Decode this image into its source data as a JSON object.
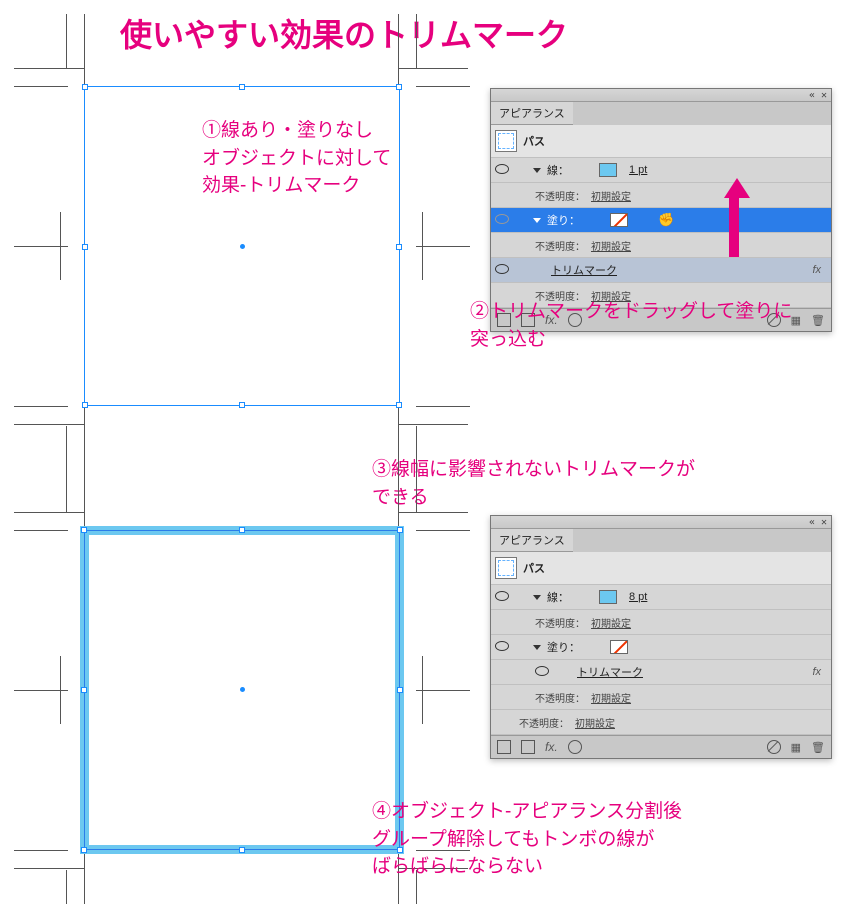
{
  "title": "使いやすい効果のトリムマーク",
  "annotations": {
    "a1_l1": "①線あり・塗りなし",
    "a1_l2": "オブジェクトに対して",
    "a1_l3": "効果-トリムマーク",
    "a2_l1": "②トリムマークをドラッグして塗りに",
    "a2_l2": "突っ込む",
    "a3_l1": "③線幅に影響されないトリムマークが",
    "a3_l2": "できる",
    "a4_l1": "④オブジェクト-アピアランス分割後",
    "a4_l2": "グループ解除してもトンボの線が",
    "a4_l3": "ばらばらにならない"
  },
  "panel1": {
    "tab": "アピアランス",
    "obj": "パス",
    "stroke_label": "線：",
    "stroke_value": "1 pt",
    "opacity_label": "不透明度：",
    "opacity_value": "初期設定",
    "fill_label": "塗り：",
    "trimmark_label": "トリムマーク",
    "fx": "fx"
  },
  "panel2": {
    "tab": "アピアランス",
    "obj": "パス",
    "stroke_label": "線：",
    "stroke_value": "8 pt",
    "opacity_label": "不透明度：",
    "opacity_value": "初期設定",
    "fill_label": "塗り：",
    "trimmark_label": "トリムマーク",
    "fx": "fx"
  },
  "footer": {
    "fx": "fx."
  }
}
